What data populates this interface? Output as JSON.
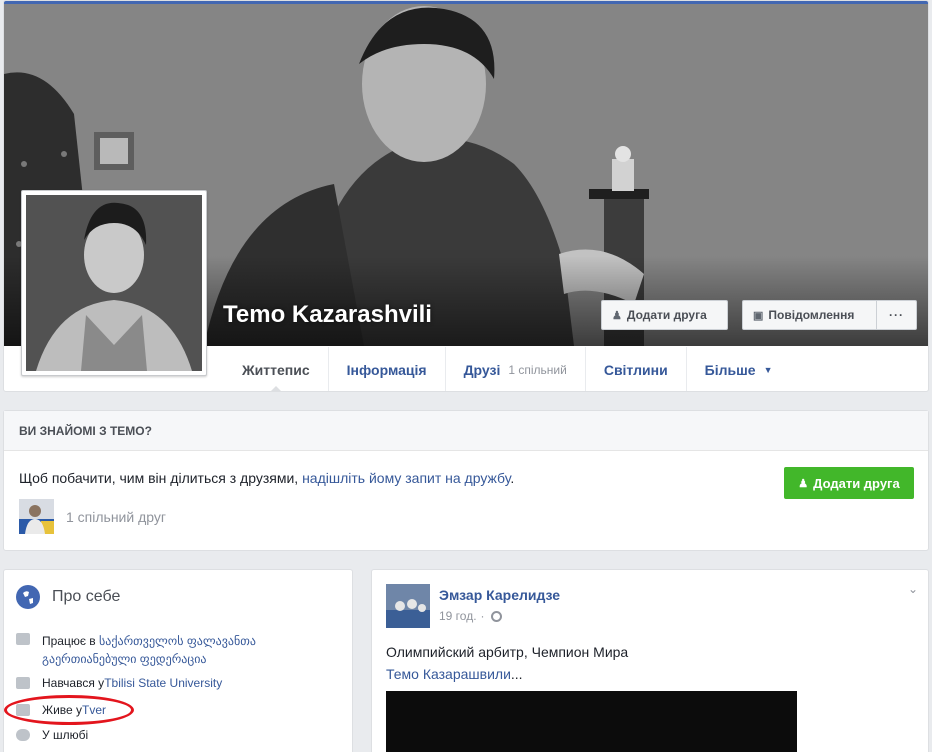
{
  "profile": {
    "name": "Temo Kazarashvili",
    "add_friend_label": "Додати друга",
    "message_label": "Повідомлення",
    "more_label": "···"
  },
  "tabs": [
    {
      "label": "Життепис"
    },
    {
      "label": "Інформація"
    },
    {
      "label": "Друзі",
      "sub": "1 спільний"
    },
    {
      "label": "Світлини"
    },
    {
      "label": "Більше"
    }
  ],
  "know_card": {
    "heading": "ВИ ЗНАЙОМІ З ТЕМО?",
    "text": "Щоб побачити, чим він ділиться з друзями, ",
    "link": "надішліть йому запит на дружбу",
    "text_end": ".",
    "button_label": "Додати друга",
    "mutual": "1 спільний друг"
  },
  "about": {
    "title": "Про себе",
    "work_prefix": "Працює в ",
    "work_value": "საქართველოს ფალავანთა გაერთიანებული ფედერაცია",
    "study_prefix": "Навчався у ",
    "study_value": "Tbilisi State University",
    "lives_prefix": "Живе у ",
    "lives_value": "Tver",
    "relationship": "У шлюбі"
  },
  "post": {
    "author": "Эмзар Карелидзе",
    "time": "19 год.",
    "text": "Олимпийский арбитр, Чемпион Мира",
    "tag": "Темо Казарашвили",
    "ellipsis": "..."
  },
  "colors": {
    "link": "#365899",
    "green_button": "#42b72a",
    "highlight_oval": "#e3151d"
  }
}
